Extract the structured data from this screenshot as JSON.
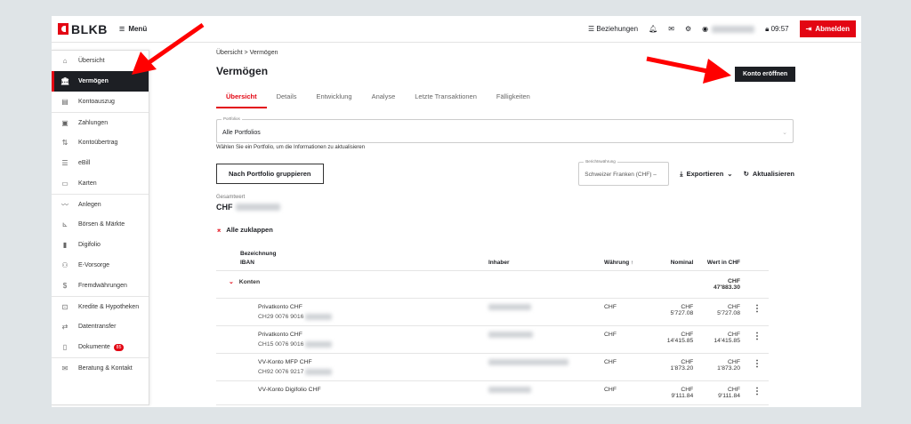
{
  "header": {
    "brand": "BLKB",
    "menu_label": "Menü",
    "relations_label": "Beziehungen",
    "time": "09:57",
    "logout_label": "Abmelden"
  },
  "sidebar": {
    "items": [
      {
        "label": "Übersicht"
      },
      {
        "label": "Vermögen"
      },
      {
        "label": "Kontoauszug"
      },
      {
        "label": "Zahlungen"
      },
      {
        "label": "Kontoübertrag"
      },
      {
        "label": "eBill"
      },
      {
        "label": "Karten"
      },
      {
        "label": "Anlegen"
      },
      {
        "label": "Börsen & Märkte"
      },
      {
        "label": "Digifolio"
      },
      {
        "label": "E-Vorsorge"
      },
      {
        "label": "Fremdwährungen"
      },
      {
        "label": "Kredite & Hypotheken"
      },
      {
        "label": "Datentransfer"
      },
      {
        "label": "Dokumente",
        "badge": "85"
      },
      {
        "label": "Beratung & Kontakt"
      }
    ]
  },
  "main": {
    "breadcrumb": {
      "home": "Übersicht",
      "sep": ">",
      "current": "Vermögen"
    },
    "title": "Vermögen",
    "open_account_label": "Konto eröffnen",
    "tabs": [
      {
        "label": "Übersicht"
      },
      {
        "label": "Details"
      },
      {
        "label": "Entwicklung"
      },
      {
        "label": "Analyse"
      },
      {
        "label": "Letzte Transaktionen"
      },
      {
        "label": "Fälligkeiten"
      }
    ],
    "portfolio": {
      "label": "Portfolios",
      "value": "Alle Portfolios",
      "hint": "Wählen Sie ein Portfolio, um die Informationen zu aktualisieren"
    },
    "group_button": "Nach Portfolio gruppieren",
    "currency": {
      "label": "Berichtswährung",
      "value": "Schweizer Franken (CHF) –"
    },
    "export_label": "Exportieren",
    "refresh_label": "Aktualisieren",
    "total": {
      "label": "Gesamtwert",
      "currency": "CHF"
    },
    "collapse_label": "Alle zuklappen",
    "table": {
      "headers": {
        "name": "Bezeichnung",
        "iban": "IBAN",
        "owner": "Inhaber",
        "currency": "Währung",
        "nominal": "Nominal",
        "value": "Wert in CHF"
      },
      "group": {
        "label": "Konten",
        "total": "CHF 47'883.30"
      },
      "rows": [
        {
          "name": "Privatkonto CHF",
          "iban": "CH29 0076 9016",
          "currency": "CHF",
          "nominal": "CHF 5'727.08",
          "value": "CHF 5'727.08"
        },
        {
          "name": "Privatkonto CHF",
          "iban": "CH15 0076 9016",
          "currency": "CHF",
          "nominal": "CHF 14'415.85",
          "value": "CHF 14'415.85"
        },
        {
          "name": "VV-Konto MFP CHF",
          "iban": "CH92 0076 9217",
          "currency": "CHF",
          "nominal": "CHF 1'873.20",
          "value": "CHF 1'873.20"
        },
        {
          "name": "VV-Konto Digifolio CHF",
          "iban": "",
          "currency": "CHF",
          "nominal": "CHF 9'111.84",
          "value": "CHF 9'111.84"
        }
      ]
    }
  },
  "colors": {
    "brand": "#e30613",
    "dark": "#1d1f24"
  }
}
